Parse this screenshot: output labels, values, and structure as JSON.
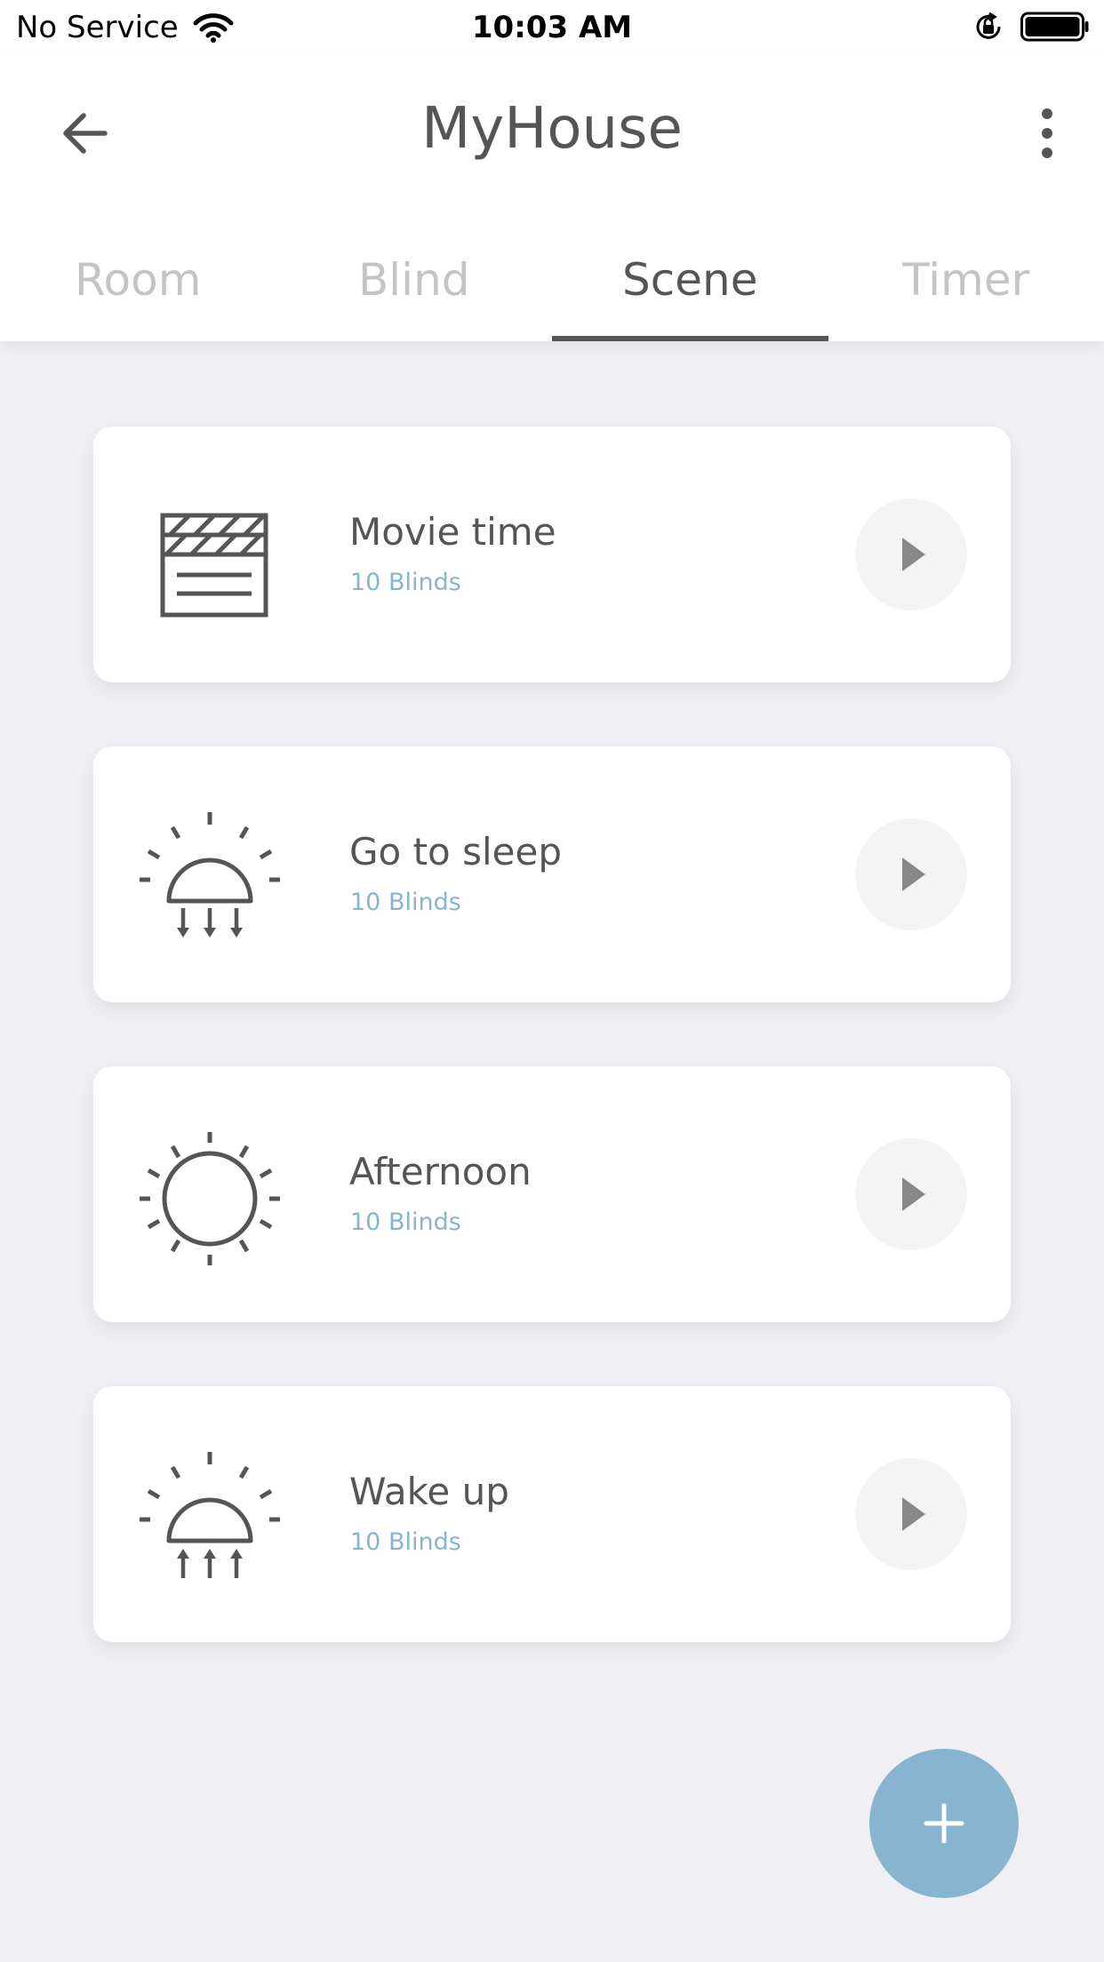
{
  "status_bar": {
    "carrier": "No Service",
    "time": "10:03 AM"
  },
  "header": {
    "title": "MyHouse"
  },
  "tabs": [
    {
      "label": "Room",
      "active": false
    },
    {
      "label": "Blind",
      "active": false
    },
    {
      "label": "Scene",
      "active": true
    },
    {
      "label": "Timer",
      "active": false
    }
  ],
  "scenes": [
    {
      "name": "Movie time",
      "count": "10 Blinds",
      "icon": "clapperboard-icon"
    },
    {
      "name": "Go to sleep",
      "count": "10 Blinds",
      "icon": "sunset-icon"
    },
    {
      "name": "Afternoon",
      "count": "10 Blinds",
      "icon": "sun-icon"
    },
    {
      "name": "Wake up",
      "count": "10 Blinds",
      "icon": "sunrise-icon"
    }
  ],
  "colors": {
    "accent": "#87b5cf",
    "subtitle": "#88b4cc",
    "text": "#555555",
    "tab_inactive": "#c4c4c4",
    "background": "#efeff4"
  }
}
